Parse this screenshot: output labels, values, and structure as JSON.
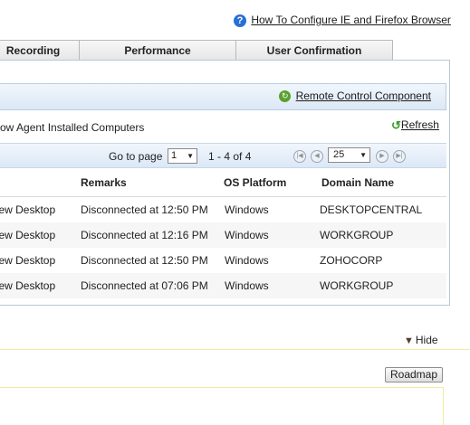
{
  "header": {
    "help_icon": "?",
    "help_link": "How To Configure IE and Firefox Browser"
  },
  "tabs": [
    {
      "label": "Recording"
    },
    {
      "label": "Performance"
    },
    {
      "label": "User Confirmation"
    }
  ],
  "toolbar": {
    "remote_control_link": "Remote Control Component",
    "view_label": "ow Agent Installed Computers",
    "refresh_label": "Refresh"
  },
  "pager": {
    "goto_label": "Go to page",
    "page_value": "1",
    "range_text": "1 - 4 of 4",
    "page_size": "25"
  },
  "table": {
    "columns": {
      "remarks": "Remarks",
      "os": "OS Platform",
      "domain": "Domain Name"
    },
    "rows": [
      {
        "action": "View Desktop",
        "remarks": "Disconnected at 12:50 PM",
        "os": "Windows",
        "domain": "DESKTOPCENTRAL"
      },
      {
        "action": "View Desktop",
        "remarks": "Disconnected at 12:16 PM",
        "os": "Windows",
        "domain": "WORKGROUP"
      },
      {
        "action": "View Desktop",
        "remarks": "Disconnected at 12:50 PM",
        "os": "Windows",
        "domain": "ZOHOCORP"
      },
      {
        "action": "View Desktop",
        "remarks": "Disconnected at 07:06 PM",
        "os": "Windows",
        "domain": "WORKGROUP"
      }
    ]
  },
  "bottom": {
    "hide_label": "Hide",
    "roadmap_label": "Roadmap"
  }
}
